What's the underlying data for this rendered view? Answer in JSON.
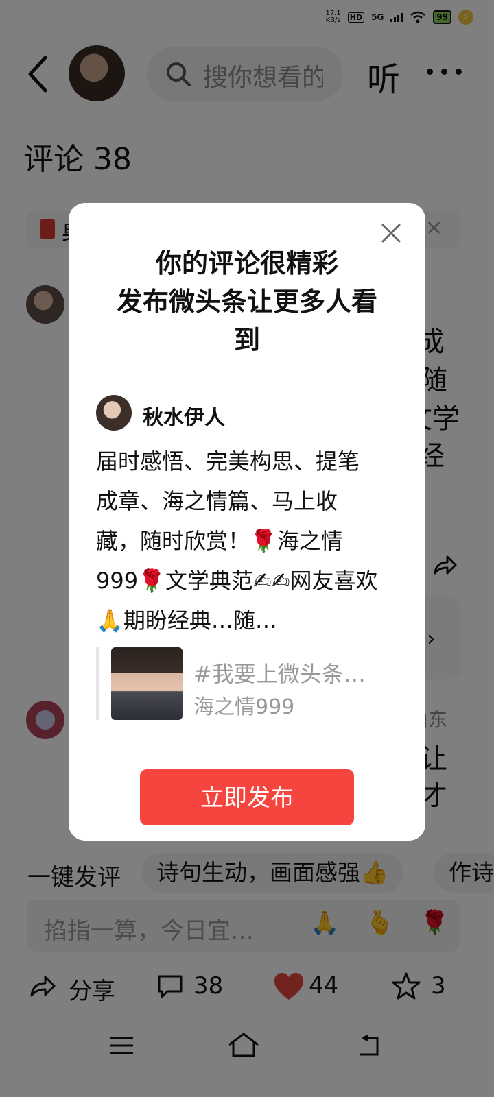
{
  "status": {
    "speed": "17.1",
    "speed_unit": "KB/s",
    "hd": "HD",
    "network": "5G",
    "battery": "99"
  },
  "header": {
    "search_placeholder": "搜你想看的",
    "listen": "听"
  },
  "comments": {
    "title": "评论 38"
  },
  "background_fragments": {
    "redpacket_text": "奥",
    "line1": "成",
    "line2": "随",
    "line3": "文学",
    "line4": "经",
    "line5": "让",
    "line6": "才",
    "location": "山东"
  },
  "dialog": {
    "title_line1": "你的评论很精彩",
    "title_line2": "发布微头条让更多人看",
    "title_line3": "到",
    "user_name": "秋水伊人",
    "text": "届时感悟、完美构思、提笔成章、海之情篇、马上收藏，随时欣赏！🌹海之情999🌹文学典范✍✍网友喜欢🙏期盼经典…随…",
    "quote_tag": "#我要上微头条…",
    "quote_author": "海之情999",
    "publish_button": "立即发布"
  },
  "chips": {
    "first": "一键发评",
    "chip1": "诗句生动，画面感强👍",
    "chip2": "作诗"
  },
  "comment_input": {
    "placeholder": "掐指一算，今日宜…",
    "emoji1": "🙏",
    "emoji2": "🫰",
    "emoji3": "🌹"
  },
  "bottom_bar": {
    "share": "分享",
    "comments": "38",
    "likes": "44",
    "favorites": "3"
  },
  "colors": {
    "accent": "#f5453e",
    "heart": "#e0463e"
  }
}
